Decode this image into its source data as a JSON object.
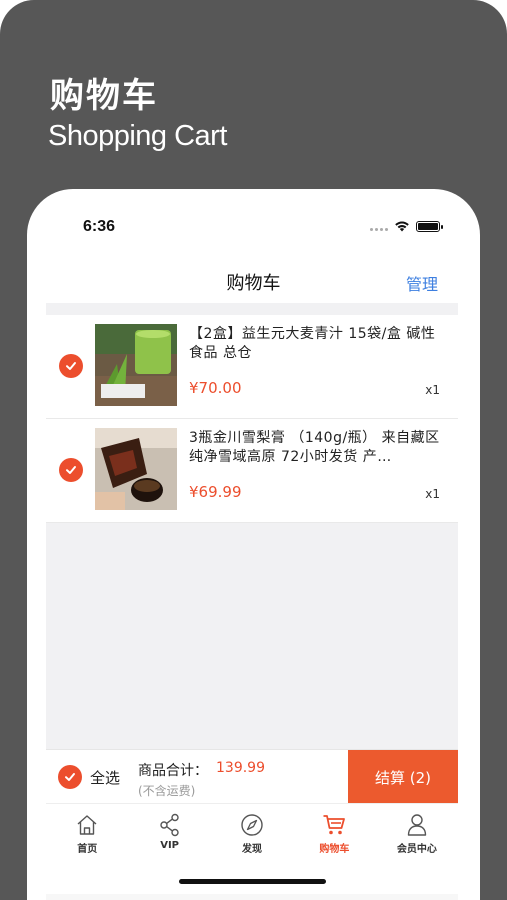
{
  "promo": {
    "title": "购物车",
    "subtitle": "Shopping Cart"
  },
  "status_bar": {
    "time": "6:36"
  },
  "nav": {
    "title": "购物车",
    "manage": "管理"
  },
  "cart": {
    "items": [
      {
        "name": "【2盒】益生元大麦青汁  15袋/盒 碱性食品  总仓",
        "price": "¥70.00",
        "qty": "x1",
        "checked": true,
        "image": "green-barley-juice"
      },
      {
        "name": "3瓶金川雪梨膏  （140g/瓶） 来自藏区纯净雪域高原  72小时发货 产…",
        "price": "¥69.99",
        "qty": "x1",
        "checked": true,
        "image": "pear-paste-pouring"
      }
    ]
  },
  "summary": {
    "select_all": "全选",
    "total_label": "商品合计：",
    "total_value": "139.99",
    "shipping_note": "(不含运费)",
    "checkout": "结算 (2)"
  },
  "tabbar": {
    "tabs": [
      {
        "label": "首页",
        "icon": "home-icon",
        "active": false
      },
      {
        "label": "VIP",
        "icon": "share-icon",
        "active": false
      },
      {
        "label": "发现",
        "icon": "compass-icon",
        "active": false
      },
      {
        "label": "购物车",
        "icon": "cart-icon",
        "active": true
      },
      {
        "label": "会员中心",
        "icon": "user-icon",
        "active": false
      }
    ]
  },
  "colors": {
    "accent": "#ec4e2d",
    "link": "#3d7fe0",
    "promo_bg": "#575757"
  }
}
